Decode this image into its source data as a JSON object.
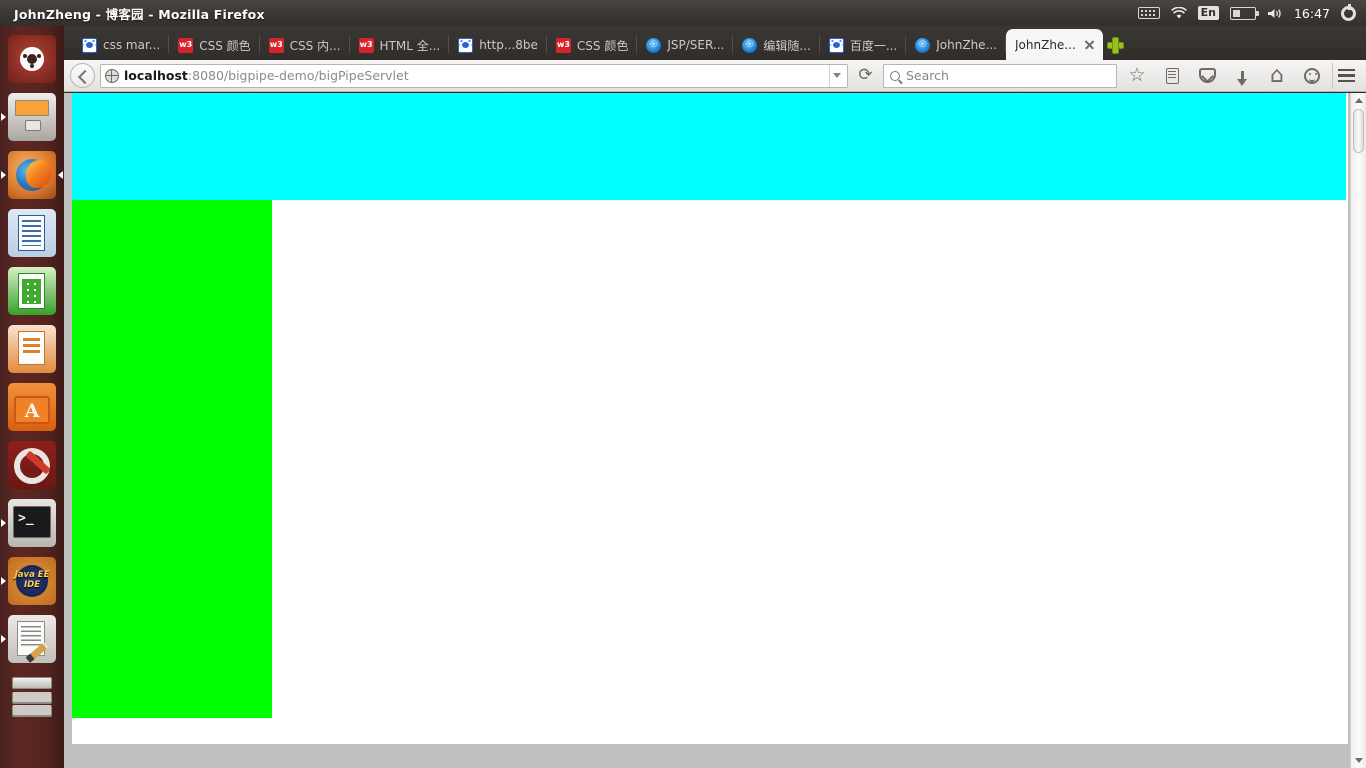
{
  "desktop": {
    "window_title": "JohnZheng - 博客园 - Mozilla Firefox",
    "tray": {
      "keyboard_icon": "keyboard-icon",
      "wifi_icon": "wifi-icon",
      "input_language": "En",
      "battery_icon": "battery-icon",
      "volume_icon": "volume-icon",
      "clock": "16:47",
      "session_icon": "gear-icon"
    },
    "launcher": [
      {
        "name": "ubuntu-dash",
        "running": false
      },
      {
        "name": "files",
        "running": true
      },
      {
        "name": "firefox",
        "running": true,
        "focused": true
      },
      {
        "name": "libreoffice-writer",
        "running": false
      },
      {
        "name": "libreoffice-calc",
        "running": false
      },
      {
        "name": "libreoffice-impress",
        "running": false
      },
      {
        "name": "ubuntu-software-center",
        "running": false
      },
      {
        "name": "system-settings",
        "running": false
      },
      {
        "name": "terminal",
        "running": true
      },
      {
        "name": "eclipse-java-ee-ide",
        "running": true,
        "label": "Java EE IDE"
      },
      {
        "name": "text-editor",
        "running": true
      },
      {
        "name": "trash",
        "running": false
      }
    ]
  },
  "browser": {
    "tabs": [
      {
        "label": "css mar...",
        "favicon": "baidu",
        "active": false
      },
      {
        "label": "CSS 颜色",
        "favicon": "w3",
        "active": false
      },
      {
        "label": "CSS 内...",
        "favicon": "w3",
        "active": false
      },
      {
        "label": "HTML 全...",
        "favicon": "w3",
        "active": false
      },
      {
        "label": "http...8be",
        "favicon": "baidu",
        "active": false
      },
      {
        "label": "CSS 颜色",
        "favicon": "w3",
        "active": false
      },
      {
        "label": "JSP/SER...",
        "favicon": "cnblogs",
        "active": false
      },
      {
        "label": "编辑随...",
        "favicon": "cnblogs",
        "active": false
      },
      {
        "label": "百度一...",
        "favicon": "baidu",
        "active": false
      },
      {
        "label": "JohnZhe...",
        "favicon": "cnblogs",
        "active": false
      },
      {
        "label": "JohnZhe...",
        "favicon": "none",
        "active": true
      }
    ],
    "favicon_w3_text": "w3",
    "favicon_cnblogs_text": "☉",
    "new_tab_label": "+",
    "toolbar": {
      "back_label": "Back",
      "reload_label": "Reload",
      "identity_icon": "globe-icon",
      "url_host": "localhost",
      "url_rest": ":8080/bigpipe-demo/bigPipeServlet",
      "url_full": "localhost:8080/bigpipe-demo/bigPipeServlet",
      "history_dropdown": "chevron-down-icon",
      "search_placeholder": "Search",
      "bookmark_label": "Bookmark this page",
      "library_label": "Show your library",
      "pocket_label": "Save to Pocket",
      "downloads_label": "Downloads",
      "home_label": "Home",
      "sync_label": "Sync",
      "menu_label": "Open menu"
    }
  },
  "page_content": {
    "header_block_color": "#00FFFF",
    "sidebar_block_color": "#00FF00",
    "page_background": "#FFFFFF",
    "viewport_background": "#C0C0C0"
  }
}
